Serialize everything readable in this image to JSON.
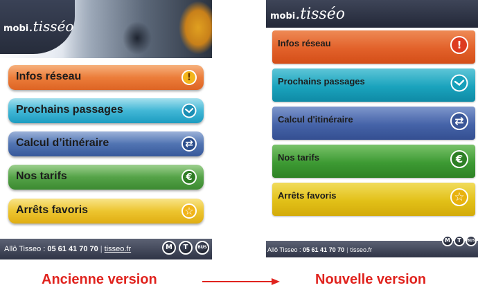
{
  "old_version": {
    "logo": {
      "word": "mobi",
      "script": ".tisséo"
    },
    "menu": [
      {
        "label": "Infos réseau",
        "icon": "exclamation-icon",
        "icon_glyph": "!",
        "color": "#e8742a"
      },
      {
        "label": "Prochains passages",
        "icon": "clock-icon",
        "icon_glyph": "",
        "color": "#2aa8c6"
      },
      {
        "label": "Calcul d’itinéraire",
        "icon": "route-arrows-icon",
        "icon_glyph": "⇄",
        "color": "#3a5a9a"
      },
      {
        "label": "Nos tarifs",
        "icon": "euro-icon",
        "icon_glyph": "€",
        "color": "#3f8f3a"
      },
      {
        "label": "Arrêts favoris",
        "icon": "star-icon",
        "icon_glyph": "☆",
        "color": "#e0b51f"
      }
    ],
    "footer": {
      "label": "Allô Tisseo : ",
      "phone": "05 61 41 70 70",
      "separator": "|",
      "link": "tisseo.fr",
      "badges": [
        "M",
        "T",
        "BUS"
      ]
    }
  },
  "new_version": {
    "logo": {
      "word": "mobi",
      "script": ".tisséo"
    },
    "menu": [
      {
        "label": "Infos réseau",
        "icon": "exclamation-icon",
        "icon_glyph": "!",
        "color": "#e2612a"
      },
      {
        "label": "Prochains passages",
        "icon": "clock-icon",
        "icon_glyph": "",
        "color": "#1aa3bd"
      },
      {
        "label": "Calcul d'itinéraire",
        "icon": "route-arrows-icon",
        "icon_glyph": "⇄",
        "color": "#4563a8"
      },
      {
        "label": "Nos tarifs",
        "icon": "euro-icon",
        "icon_glyph": "€",
        "color": "#3d9a33"
      },
      {
        "label": "Arrêts favoris",
        "icon": "star-icon",
        "icon_glyph": "☆",
        "color": "#e2c018"
      }
    ],
    "footer": {
      "label": "Allô Tisseo : ",
      "phone": "05 61 41 70 70",
      "separator": "|",
      "link": "tisseo.fr",
      "badges": [
        "M",
        "T",
        "BUS"
      ]
    }
  },
  "captions": {
    "old": "Ancienne version",
    "new": "Nouvelle version",
    "color": "#e0231e"
  }
}
